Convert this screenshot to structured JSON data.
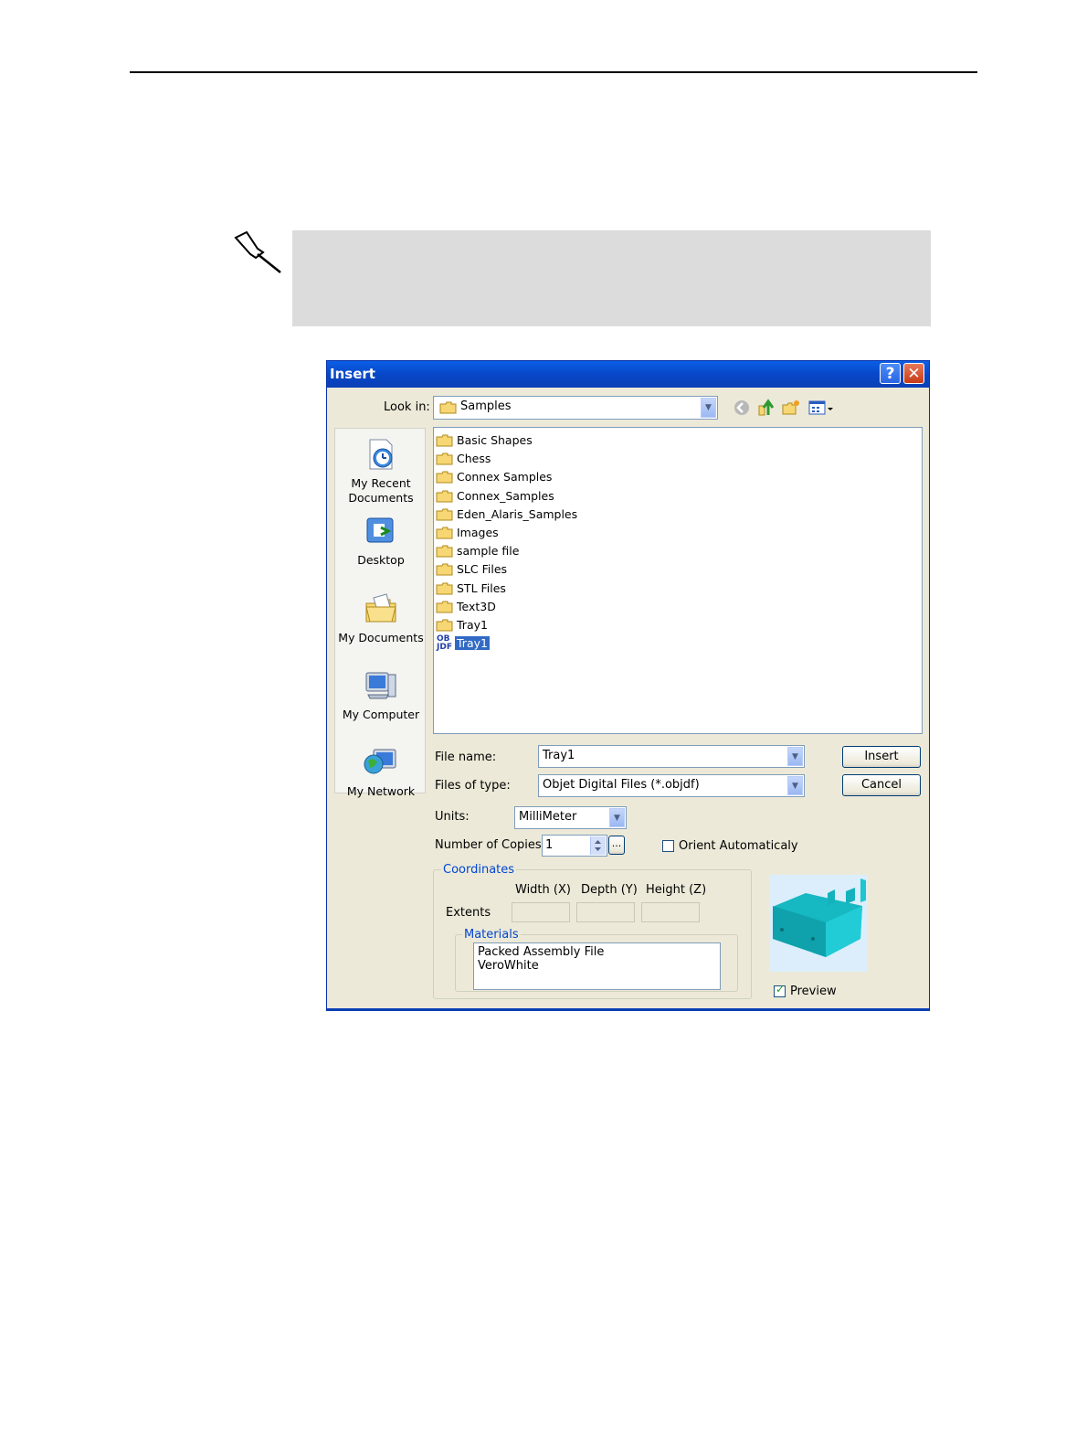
{
  "dialog": {
    "title": "Insert",
    "help_glyph": "?",
    "close_glyph": "✕",
    "look_in_label": "Look in:",
    "look_in_value": "Samples",
    "places": [
      {
        "label_line1": "My Recent",
        "label_line2": "Documents",
        "icon": "recent-documents-icon"
      },
      {
        "label_line1": "Desktop",
        "label_line2": "",
        "icon": "desktop-icon"
      },
      {
        "label_line1": "My Documents",
        "label_line2": "",
        "icon": "my-documents-icon"
      },
      {
        "label_line1": "My Computer",
        "label_line2": "",
        "icon": "my-computer-icon"
      },
      {
        "label_line1": "My Network",
        "label_line2": "",
        "icon": "my-network-icon"
      }
    ],
    "files": [
      {
        "name": "Basic Shapes",
        "type": "folder"
      },
      {
        "name": "Chess",
        "type": "folder"
      },
      {
        "name": "Connex Samples",
        "type": "folder"
      },
      {
        "name": "Connex_Samples",
        "type": "folder"
      },
      {
        "name": "Eden_Alaris_Samples",
        "type": "folder"
      },
      {
        "name": "Images",
        "type": "folder"
      },
      {
        "name": "sample file",
        "type": "folder"
      },
      {
        "name": "SLC Files",
        "type": "folder"
      },
      {
        "name": "STL Files",
        "type": "folder"
      },
      {
        "name": "Text3D",
        "type": "folder"
      },
      {
        "name": "Tray1",
        "type": "folder"
      },
      {
        "name": "Tray1",
        "type": "objdf",
        "selected": true
      }
    ],
    "objdf_icon_text": {
      "line1": "OB",
      "line2": "JDF"
    },
    "file_name_label": "File name:",
    "file_name_value": "Tray1",
    "files_of_type_label": "Files of type:",
    "files_of_type_value": "Objet Digital Files (*.objdf)",
    "insert_button": "Insert",
    "cancel_button": "Cancel",
    "units_label": "Units:",
    "units_value": "MilliMeter",
    "copies_label": "Number of Copies :",
    "copies_value": "1",
    "copies_more": "...",
    "orient_label": "Orient Automaticaly",
    "orient_checked": false,
    "coordinates_title": "Coordinates",
    "width_label": "Width (X)",
    "depth_label": "Depth (Y)",
    "height_label": "Height (Z)",
    "extents_label": "Extents",
    "materials_title": "Materials",
    "materials": [
      "Packed Assembly File",
      "VeroWhite"
    ],
    "preview_label": "Preview",
    "preview_checked": true,
    "check_glyph": "✓"
  }
}
